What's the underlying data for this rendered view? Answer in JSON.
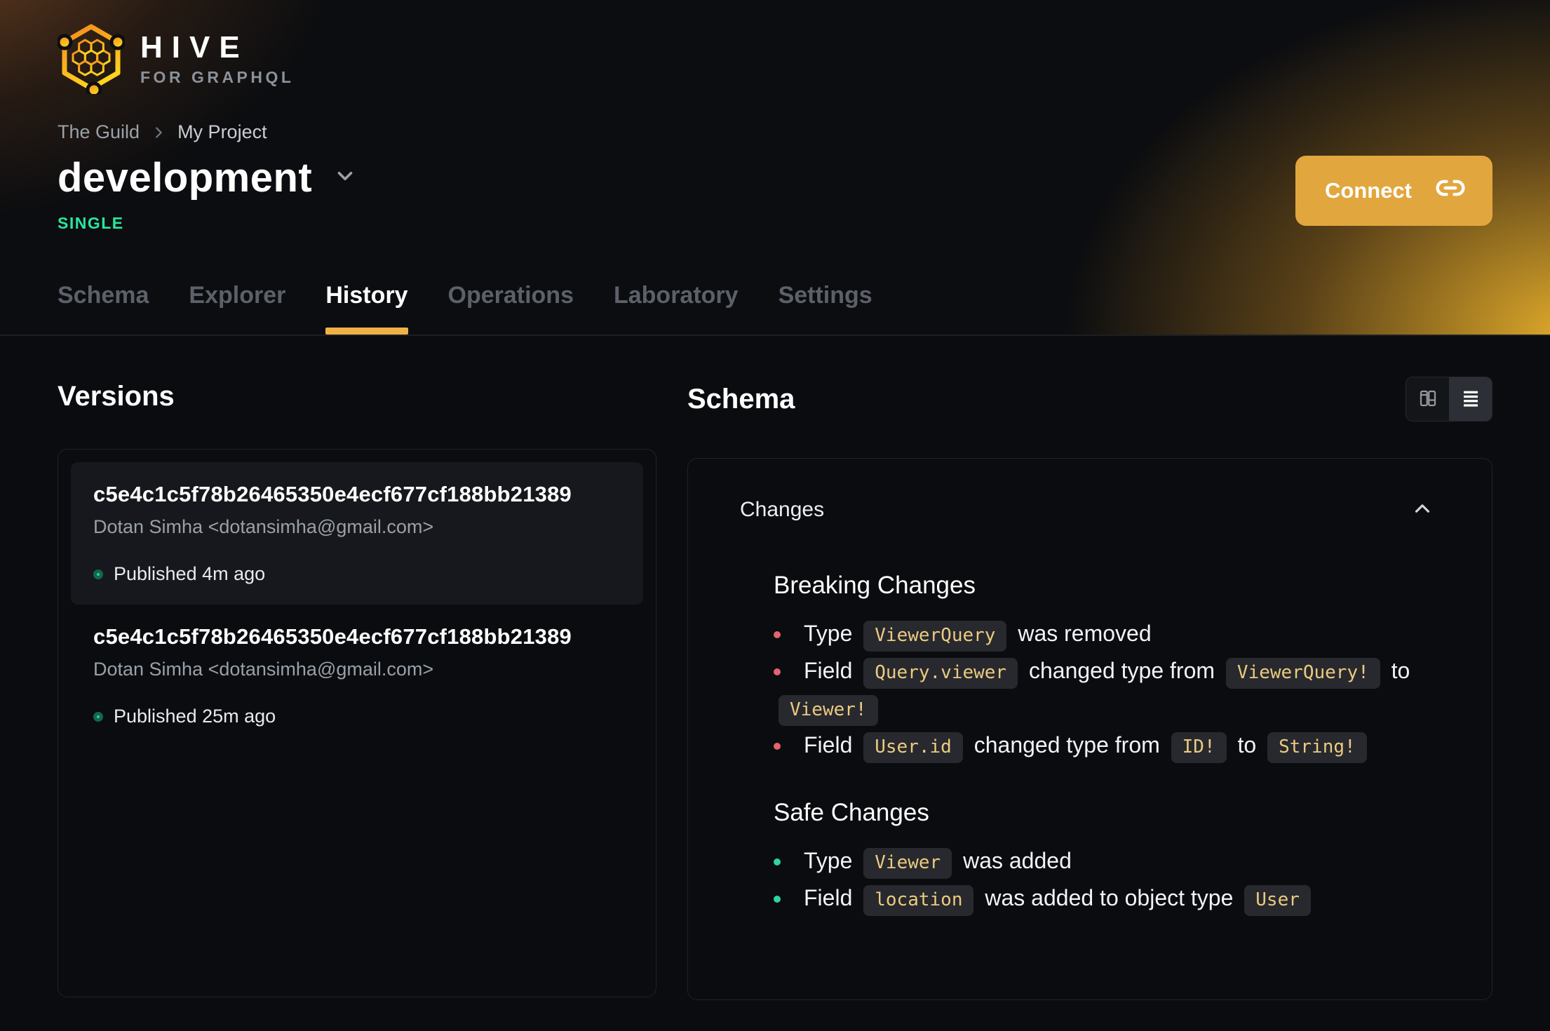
{
  "brand": {
    "name": "HIVE",
    "tagline": "FOR GRAPHQL"
  },
  "breadcrumb": {
    "org": "The Guild",
    "project": "My Project"
  },
  "header": {
    "title": "development",
    "badge": "SINGLE",
    "connect_label": "Connect"
  },
  "colors": {
    "accent": "#f0b246",
    "connect_bg": "#e2a63e",
    "badge_green": "#2ae69d",
    "published_dot": "#2bd292",
    "breaking_bullet": "#e4636e",
    "safe_bullet": "#2fd49a",
    "chip_text": "#ecca80",
    "chip_bg": "#27292e"
  },
  "tabs": [
    {
      "label": "Schema",
      "active": false
    },
    {
      "label": "Explorer",
      "active": false
    },
    {
      "label": "History",
      "active": true
    },
    {
      "label": "Operations",
      "active": false
    },
    {
      "label": "Laboratory",
      "active": false
    },
    {
      "label": "Settings",
      "active": false
    }
  ],
  "versions": {
    "heading": "Versions",
    "items": [
      {
        "hash": "c5e4c1c5f78b26465350e4ecf677cf188bb21389",
        "author": "Dotan Simha <dotansimha@gmail.com>",
        "status": "Published 4m ago",
        "current": true
      },
      {
        "hash": "c5e4c1c5f78b26465350e4ecf677cf188bb21389",
        "author": "Dotan Simha <dotansimha@gmail.com>",
        "status": "Published 25m ago",
        "current": false
      }
    ]
  },
  "schema": {
    "heading": "Schema",
    "changes_label": "Changes",
    "sections": [
      {
        "title": "Breaking Changes",
        "severity": "breaking",
        "items": [
          {
            "segments": [
              {
                "t": "text",
                "v": "Type"
              },
              {
                "t": "code",
                "v": "ViewerQuery"
              },
              {
                "t": "text",
                "v": "was removed"
              }
            ]
          },
          {
            "segments": [
              {
                "t": "text",
                "v": "Field"
              },
              {
                "t": "code",
                "v": "Query.viewer"
              },
              {
                "t": "text",
                "v": "changed type from"
              },
              {
                "t": "code",
                "v": "ViewerQuery!"
              },
              {
                "t": "text",
                "v": "to"
              },
              {
                "t": "code",
                "v": "Viewer!"
              }
            ]
          },
          {
            "segments": [
              {
                "t": "text",
                "v": "Field"
              },
              {
                "t": "code",
                "v": "User.id"
              },
              {
                "t": "text",
                "v": "changed type from"
              },
              {
                "t": "code",
                "v": "ID!"
              },
              {
                "t": "text",
                "v": "to"
              },
              {
                "t": "code",
                "v": "String!"
              }
            ]
          }
        ]
      },
      {
        "title": "Safe Changes",
        "severity": "safe",
        "items": [
          {
            "segments": [
              {
                "t": "text",
                "v": "Type"
              },
              {
                "t": "code",
                "v": "Viewer"
              },
              {
                "t": "text",
                "v": "was added"
              }
            ]
          },
          {
            "segments": [
              {
                "t": "text",
                "v": "Field"
              },
              {
                "t": "code",
                "v": "location"
              },
              {
                "t": "text",
                "v": "was added to object type"
              },
              {
                "t": "code",
                "v": "User"
              }
            ]
          }
        ]
      }
    ]
  }
}
